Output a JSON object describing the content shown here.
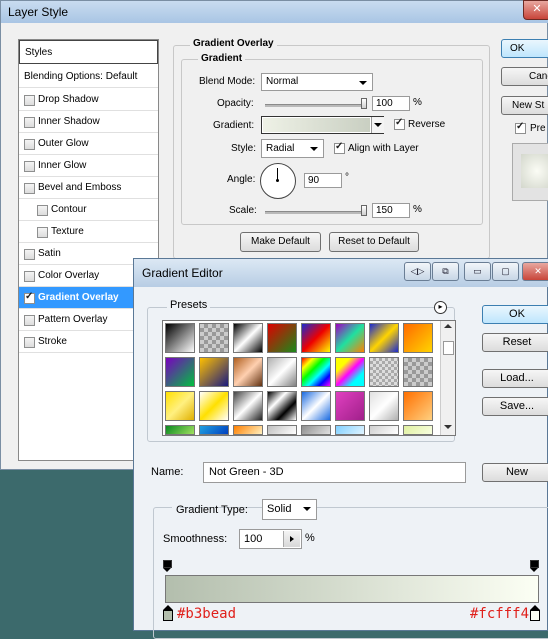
{
  "layer_style": {
    "title": "Layer Style",
    "close_glyph": "✕",
    "styles_header": "Styles",
    "blending_options": "Blending Options: Default",
    "items": [
      {
        "label": "Drop Shadow",
        "checked": false,
        "indent": false,
        "selected": false
      },
      {
        "label": "Inner Shadow",
        "checked": false,
        "indent": false,
        "selected": false
      },
      {
        "label": "Outer Glow",
        "checked": false,
        "indent": false,
        "selected": false
      },
      {
        "label": "Inner Glow",
        "checked": false,
        "indent": false,
        "selected": false
      },
      {
        "label": "Bevel and Emboss",
        "checked": false,
        "indent": false,
        "selected": false
      },
      {
        "label": "Contour",
        "checked": false,
        "indent": true,
        "selected": false
      },
      {
        "label": "Texture",
        "checked": false,
        "indent": true,
        "selected": false
      },
      {
        "label": "Satin",
        "checked": false,
        "indent": false,
        "selected": false
      },
      {
        "label": "Color Overlay",
        "checked": false,
        "indent": false,
        "selected": false
      },
      {
        "label": "Gradient Overlay",
        "checked": true,
        "indent": false,
        "selected": true
      },
      {
        "label": "Pattern Overlay",
        "checked": false,
        "indent": false,
        "selected": false
      },
      {
        "label": "Stroke",
        "checked": false,
        "indent": false,
        "selected": false
      }
    ],
    "section_title": "Gradient Overlay",
    "group_title": "Gradient",
    "blend_mode_label": "Blend Mode:",
    "blend_mode_value": "Normal",
    "opacity_label": "Opacity:",
    "opacity_value": "100",
    "percent": "%",
    "opacity_level": 1.0,
    "gradient_label": "Gradient:",
    "reverse_label": "Reverse",
    "reverse_checked": true,
    "style_label": "Style:",
    "style_value": "Radial",
    "align_label": "Align with Layer",
    "align_checked": true,
    "angle_label": "Angle:",
    "angle_value": "90",
    "degree": "°",
    "scale_label": "Scale:",
    "scale_value": "150",
    "scale_level": 1.0,
    "make_default": "Make Default",
    "reset_default": "Reset to Default",
    "ok": "OK",
    "cancel": "Canc",
    "new_style": "New St",
    "preview": "Pre"
  },
  "gradient_editor": {
    "title": "Gradient Editor",
    "presets_label": "Presets",
    "menu_glyph": "▸",
    "ok": "OK",
    "reset": "Reset",
    "load": "Load...",
    "save": "Save...",
    "name_label": "Name:",
    "name_value": "Not Green - 3D",
    "new_button": "New",
    "gradient_type_label": "Gradient Type:",
    "gradient_type_value": "Solid",
    "smoothness_label": "Smoothness:",
    "smoothness_value": "100",
    "smoothness_percent": "%",
    "stop_left_color": "#b3bead",
    "stop_right_color": "#fcfff4",
    "stop_left_label": "#b3bead",
    "stop_right_label": "#fcfff4",
    "title_icons": [
      "◁▷",
      "⧉",
      "▭",
      "▢",
      "✕"
    ]
  },
  "colors": {
    "selection": "#3399ff",
    "annotation_red": "#e0201b",
    "gradient_start": "#eef1e6",
    "gradient_end": "#c9cfc2"
  }
}
